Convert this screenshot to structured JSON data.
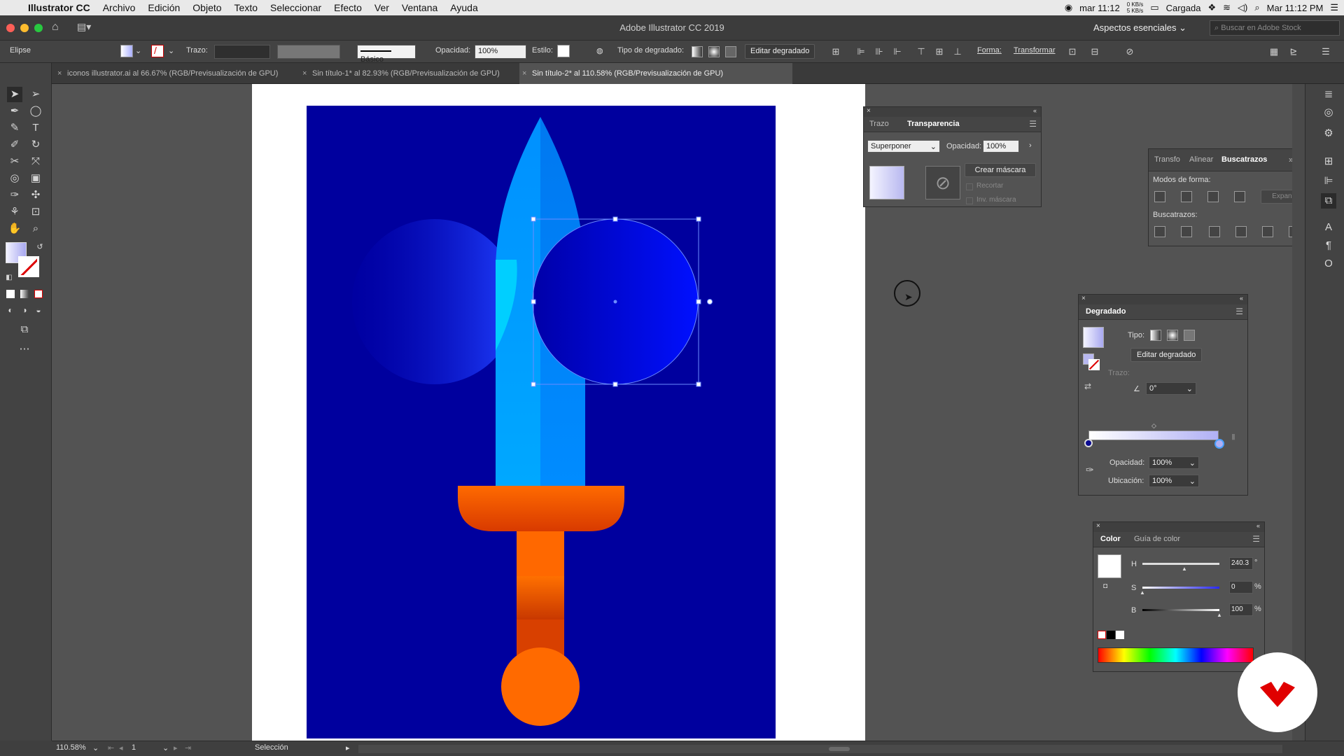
{
  "menubar": {
    "app": "Illustrator CC",
    "items": [
      "Archivo",
      "Edición",
      "Objeto",
      "Texto",
      "Seleccionar",
      "Efecto",
      "Ver",
      "Ventana",
      "Ayuda"
    ],
    "clock_short": "mar 11:12",
    "net_up": "0 KB/s",
    "net_down": "5 KB/s",
    "battery": "Cargada",
    "clock_long": "Mar 11:12 PM"
  },
  "window": {
    "title": "Adobe Illustrator CC 2019",
    "workspace": "Aspectos esenciales",
    "search_placeholder": "Buscar en Adobe Stock"
  },
  "controlbar": {
    "object": "Elipse",
    "stroke_label": "Trazo:",
    "brush": "Básico",
    "opacity_label": "Opacidad:",
    "opacity_value": "100%",
    "style_label": "Estilo:",
    "gradient_type_label": "Tipo de degradado:",
    "edit_gradient": "Editar degradado",
    "shape_label": "Forma:",
    "transform_label": "Transformar"
  },
  "tabs": [
    {
      "label": "iconos illustrator.ai al 66.67% (RGB/Previsualización de GPU)"
    },
    {
      "label": "Sin título-1* al 82.93% (RGB/Previsualización de GPU)"
    },
    {
      "label": "Sin título-2* al 110.58% (RGB/Previsualización de GPU)"
    }
  ],
  "transparency_panel": {
    "tab_stroke": "Trazo",
    "tab_transparency": "Transparencia",
    "blend_mode": "Superponer",
    "opacity_label": "Opacidad:",
    "opacity_value": "100%",
    "make_mask": "Crear máscara",
    "clip": "Recortar",
    "invert_mask": "Inv. máscara"
  },
  "pathfinder_panel": {
    "tab_transform": "Transfo",
    "tab_align": "Alinear",
    "tab_pathfinder": "Buscatrazos",
    "shape_modes": "Modos de forma:",
    "expand": "Expandir",
    "pathfinders": "Buscatrazos:"
  },
  "gradient_panel": {
    "title": "Degradado",
    "type_label": "Tipo:",
    "edit_gradient": "Editar degradado",
    "stroke_label": "Trazo:",
    "angle_value": "0°",
    "opacity_label": "Opacidad:",
    "opacity_value": "100%",
    "location_label": "Ubicación:",
    "location_value": "100%"
  },
  "color_panel": {
    "tab_color": "Color",
    "tab_guide": "Guía de color",
    "h_label": "H",
    "h_value": "240.3",
    "h_unit": "°",
    "h_level": 0.667,
    "s_label": "S",
    "s_value": "0",
    "s_unit": "%",
    "s_level": 0,
    "b_label": "B",
    "b_value": "100",
    "b_unit": "%",
    "b_level": 1
  },
  "status": {
    "zoom": "110.58%",
    "page": "1",
    "tool": "Selección"
  },
  "colors": {
    "artboard": "#00009e",
    "blade_light": "#00c8ff",
    "blade_dark": "#0080ff",
    "hilt": "#ff6a00",
    "brand": "#e00000"
  }
}
